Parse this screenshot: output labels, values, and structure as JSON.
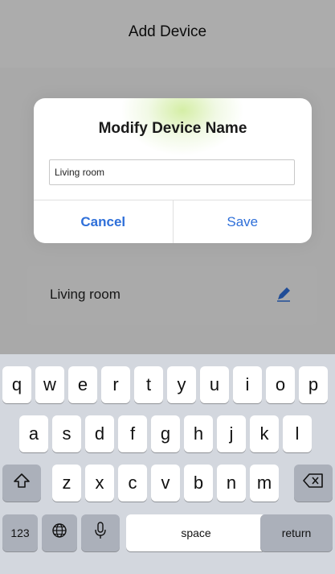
{
  "nav": {
    "title": "Add Device"
  },
  "device_row": {
    "label": "Living room",
    "edit_icon": "pencil-icon"
  },
  "dialog": {
    "title": "Modify Device Name",
    "input_value": "Living room",
    "cancel_label": "Cancel",
    "save_label": "Save"
  },
  "keyboard": {
    "row1": [
      "q",
      "w",
      "e",
      "r",
      "t",
      "y",
      "u",
      "i",
      "o",
      "p"
    ],
    "row2": [
      "a",
      "s",
      "d",
      "f",
      "g",
      "h",
      "j",
      "k",
      "l"
    ],
    "row3": [
      "z",
      "x",
      "c",
      "v",
      "b",
      "n",
      "m"
    ],
    "numbers_label": "123",
    "space_label": "space",
    "return_label": "return",
    "shift_icon": "shift-icon",
    "globe_icon": "globe-icon",
    "mic_icon": "microphone-icon",
    "delete_icon": "backspace-icon"
  },
  "colors": {
    "accent": "#2e6fd9",
    "keyboard_bg": "#d3d7de",
    "special_key": "#abb0ba"
  }
}
